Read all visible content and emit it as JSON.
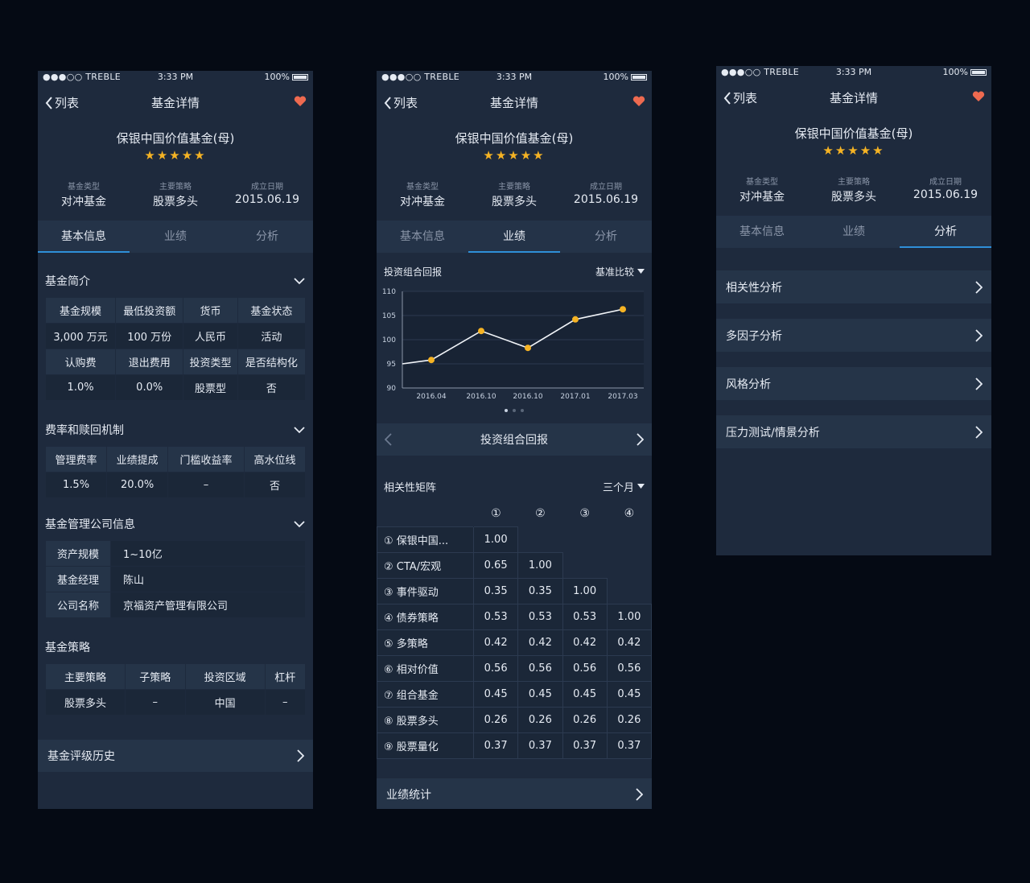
{
  "common": {
    "status": {
      "carrier": "●●●○○ TREBLE",
      "time": "3:33 PM",
      "battery": "100%"
    },
    "nav": {
      "back": "列表",
      "title": "基金详情"
    },
    "fund": {
      "name": "保银中国价值基金(母)",
      "stars": "★★★★★",
      "meta": [
        {
          "label": "基金类型",
          "value": "对冲基金"
        },
        {
          "label": "主要策略",
          "value": "股票多头"
        },
        {
          "label": "成立日期",
          "value": "2015.06.19"
        }
      ]
    },
    "tabs": [
      "基本信息",
      "业绩",
      "分析"
    ],
    "colors": {
      "bg": "#1e2a3d",
      "accent": "#2f8fd8",
      "star": "#f5b324",
      "heart": "#ee6a50",
      "point": "#f5b324"
    }
  },
  "screen1": {
    "active_tab": 0,
    "intro": {
      "title": "基金简介",
      "rows": [
        [
          "基金规模",
          "最低投资额",
          "货币",
          "基金状态"
        ],
        [
          "3,000 万元",
          "100 万份",
          "人民币",
          "活动"
        ],
        [
          "认购费",
          "退出费用",
          "投资类型",
          "是否结构化"
        ],
        [
          "1.0%",
          "0.0%",
          "股票型",
          "否"
        ]
      ]
    },
    "fees": {
      "title": "费率和赎回机制",
      "rows": [
        [
          "管理费率",
          "业绩提成",
          "门槛收益率",
          "高水位线"
        ],
        [
          "1.5%",
          "20.0%",
          "–",
          "否"
        ]
      ]
    },
    "company": {
      "title": "基金管理公司信息",
      "rows": [
        [
          "资产规模",
          "1~10亿"
        ],
        [
          "基金经理",
          "陈山"
        ],
        [
          "公司名称",
          "京福资产管理有限公司"
        ]
      ]
    },
    "strategy": {
      "title": "基金策略",
      "rows": [
        [
          "主要策略",
          "子策略",
          "投资区域",
          "杠杆"
        ],
        [
          "股票多头",
          "–",
          "中国",
          "–"
        ]
      ]
    },
    "rating_history": "基金评级历史"
  },
  "screen2": {
    "active_tab": 1,
    "chart_title": "投资组合回报",
    "benchmark": "基准比较",
    "pager_label": "投资组合回报",
    "chart_data": {
      "type": "line",
      "x": [
        "2016.04",
        "2016.10",
        "2016.10",
        "2017.01",
        "2017.03"
      ],
      "ylim": [
        90,
        110
      ],
      "yticks": [
        "110",
        "105",
        "100",
        "95",
        "90"
      ],
      "start_value": 95,
      "series": [
        {
          "values": [
            95.8,
            101.8,
            98.3,
            104.2,
            106.3
          ]
        }
      ]
    },
    "corr": {
      "title": "相关性矩阵",
      "period": "三个月",
      "headers": [
        "①",
        "②",
        "③",
        "④"
      ],
      "rows": [
        {
          "label": "① 保银中国...",
          "values": [
            "1.00",
            "",
            "",
            ""
          ]
        },
        {
          "label": "② CTA/宏观",
          "values": [
            "0.65",
            "1.00",
            "",
            ""
          ]
        },
        {
          "label": "③ 事件驱动",
          "values": [
            "0.35",
            "0.35",
            "1.00",
            ""
          ]
        },
        {
          "label": "④ 债券策略",
          "values": [
            "0.53",
            "0.53",
            "0.53",
            "1.00"
          ]
        },
        {
          "label": "⑤ 多策略",
          "values": [
            "0.42",
            "0.42",
            "0.42",
            "0.42"
          ]
        },
        {
          "label": "⑥ 相对价值",
          "values": [
            "0.56",
            "0.56",
            "0.56",
            "0.56"
          ]
        },
        {
          "label": "⑦ 组合基金",
          "values": [
            "0.45",
            "0.45",
            "0.45",
            "0.45"
          ]
        },
        {
          "label": "⑧ 股票多头",
          "values": [
            "0.26",
            "0.26",
            "0.26",
            "0.26"
          ]
        },
        {
          "label": "⑨ 股票量化",
          "values": [
            "0.37",
            "0.37",
            "0.37",
            "0.37"
          ]
        }
      ]
    },
    "stats": "业绩统计"
  },
  "screen3": {
    "active_tab": 2,
    "items": [
      "相关性分析",
      "多因子分析",
      "风格分析",
      "压力测试/情景分析"
    ]
  }
}
